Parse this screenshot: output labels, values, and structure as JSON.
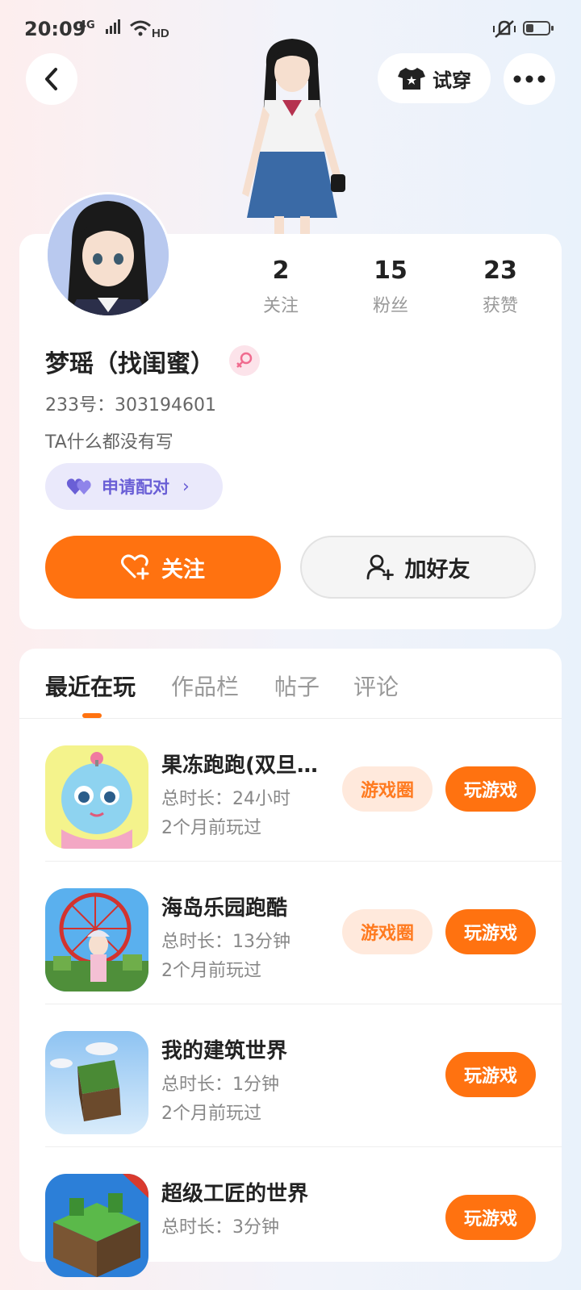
{
  "status_bar": {
    "time": "20:09",
    "network": "4G",
    "signal": "all",
    "hd": "HD"
  },
  "header": {
    "try_on_label": "试穿"
  },
  "profile": {
    "stats": [
      {
        "value": "2",
        "label": "关注"
      },
      {
        "value": "15",
        "label": "粉丝"
      },
      {
        "value": "23",
        "label": "获赞"
      }
    ],
    "name": "梦瑶（找闺蜜）",
    "id_line": "233号：303194601",
    "bio": "TA什么都没有写",
    "pair_label": "申请配对",
    "follow_label": "关注",
    "add_friend_label": "加好友"
  },
  "tabs": [
    "最近在玩",
    "作品栏",
    "帖子",
    "评论"
  ],
  "games": [
    {
      "title": "果冻跑跑(双旦…",
      "duration": "总时长：24小时",
      "last_played": "2个月前玩过",
      "circle_label": "游戏圈",
      "play_label": "玩游戏"
    },
    {
      "title": "海岛乐园跑酷",
      "duration": "总时长：13分钟",
      "last_played": "2个月前玩过",
      "circle_label": "游戏圈",
      "play_label": "玩游戏"
    },
    {
      "title": "我的建筑世界",
      "duration": "总时长：1分钟",
      "last_played": "2个月前玩过",
      "play_label": "玩游戏"
    },
    {
      "title": "超级工匠的世界",
      "duration": "总时长：3分钟",
      "last_played": "",
      "play_label": "玩游戏"
    }
  ],
  "colors": {
    "accent": "#ff7210",
    "pair_purple": "#6a5fd6",
    "gender_pink": "#f06b8f"
  }
}
